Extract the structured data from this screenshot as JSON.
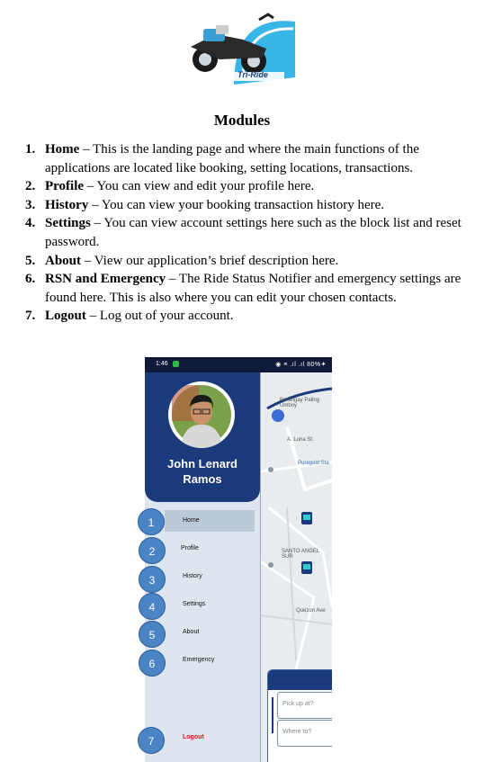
{
  "logo": {
    "text": "Tri-Ride"
  },
  "heading": "Modules",
  "modules": [
    {
      "num": "1.",
      "term": "Home",
      "desc": " – This is the landing page and where the main functions of the applications are located like booking, setting locations, transactions."
    },
    {
      "num": "2.",
      "term": "Profile",
      "desc": " – You can view and edit your profile here."
    },
    {
      "num": "3.",
      "term": "History",
      "desc": " – You can view your booking transaction history here."
    },
    {
      "num": "4.",
      "term": "Settings",
      "desc": " – You can view account settings here such as the block list and reset password."
    },
    {
      "num": "5.",
      "term": "About",
      "desc": " – View our application’s brief description here."
    },
    {
      "num": "6.",
      "term": "RSN and Emergency",
      "desc": " – The Ride Status Notifier and emergency settings are found here. This is also where you can edit your chosen contacts."
    },
    {
      "num": "7.",
      "term": "Logout",
      "desc": " – Log out of your account."
    }
  ],
  "phone": {
    "status_time": "1:46",
    "status_icons": "◉ ≡ .ıl .ıl 80%✦",
    "user_first": "John Lenard",
    "user_last": "Ramos",
    "menu": [
      "Home",
      "Profile",
      "History",
      "Settings",
      "About",
      "Emergency"
    ],
    "logout": "Logout",
    "map_labels": [
      "Barangay Paling Umboy",
      "A. Luna St.",
      "Puregold Sta",
      "SANTO ANGEL SUR",
      "Quezon Ave"
    ],
    "pickup_placeholder": "Pick up at?",
    "dropoff_placeholder": "Where to?"
  },
  "badges": [
    "1",
    "2",
    "3",
    "4",
    "5",
    "6",
    "7"
  ],
  "colors": {
    "drawer_header": "#1b3a7b",
    "badge": "#4a84c4",
    "logout": "#e0141c"
  }
}
